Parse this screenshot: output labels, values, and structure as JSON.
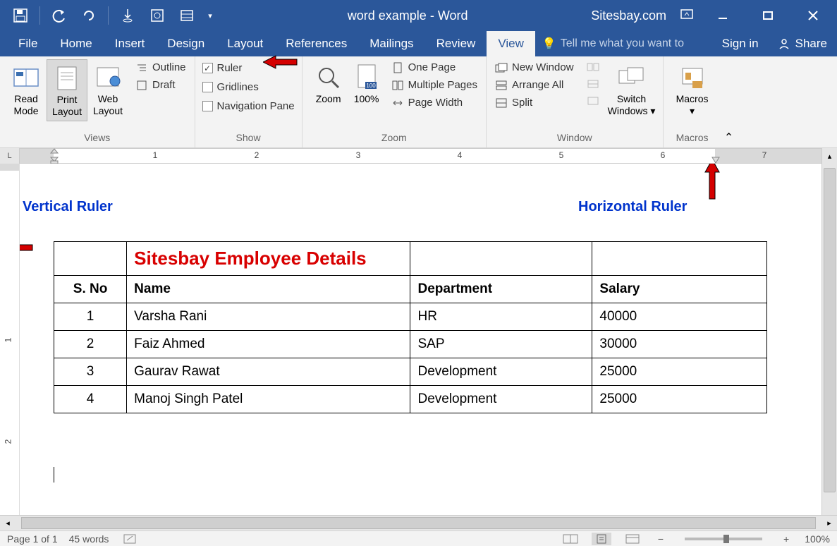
{
  "title": "word example - Word",
  "brand": "Sitesbay.com",
  "tabs": [
    "File",
    "Home",
    "Insert",
    "Design",
    "Layout",
    "References",
    "Mailings",
    "Review",
    "View"
  ],
  "active_tab": "View",
  "tellme": "Tell me what you want to",
  "signin": "Sign in",
  "share": "Share",
  "ribbon": {
    "views": {
      "label": "Views",
      "read": "Read Mode",
      "print": "Print Layout",
      "web": "Web Layout",
      "outline": "Outline",
      "draft": "Draft"
    },
    "show": {
      "label": "Show",
      "ruler": "Ruler",
      "gridlines": "Gridlines",
      "navpane": "Navigation Pane"
    },
    "zoom": {
      "label": "Zoom",
      "zoom": "Zoom",
      "hundred": "100%",
      "one": "One Page",
      "multi": "Multiple Pages",
      "width": "Page Width"
    },
    "window": {
      "label": "Window",
      "new": "New Window",
      "arrange": "Arrange All",
      "split": "Split",
      "switch": "Switch Windows"
    },
    "macros": {
      "label": "Macros",
      "macros": "Macros"
    }
  },
  "ruler_numbers": [
    "1",
    "2",
    "3",
    "4",
    "5",
    "6",
    "7"
  ],
  "annotations": {
    "vertical": "Vertical Ruler",
    "horizontal": "Horizontal Ruler"
  },
  "table": {
    "title": "Sitesbay Employee Details",
    "headers": {
      "sno": "S. No",
      "name": "Name",
      "dept": "Department",
      "salary": "Salary"
    },
    "rows": [
      {
        "sno": "1",
        "name": "Varsha Rani",
        "dept": "HR",
        "salary": "40000"
      },
      {
        "sno": "2",
        "name": "Faiz Ahmed",
        "dept": "SAP",
        "salary": "30000"
      },
      {
        "sno": "3",
        "name": "Gaurav Rawat",
        "dept": "Development",
        "salary": "25000"
      },
      {
        "sno": "4",
        "name": "Manoj Singh Patel",
        "dept": "Development",
        "salary": "25000"
      }
    ]
  },
  "status": {
    "page": "Page 1 of 1",
    "words": "45 words",
    "zoom": "100%"
  }
}
